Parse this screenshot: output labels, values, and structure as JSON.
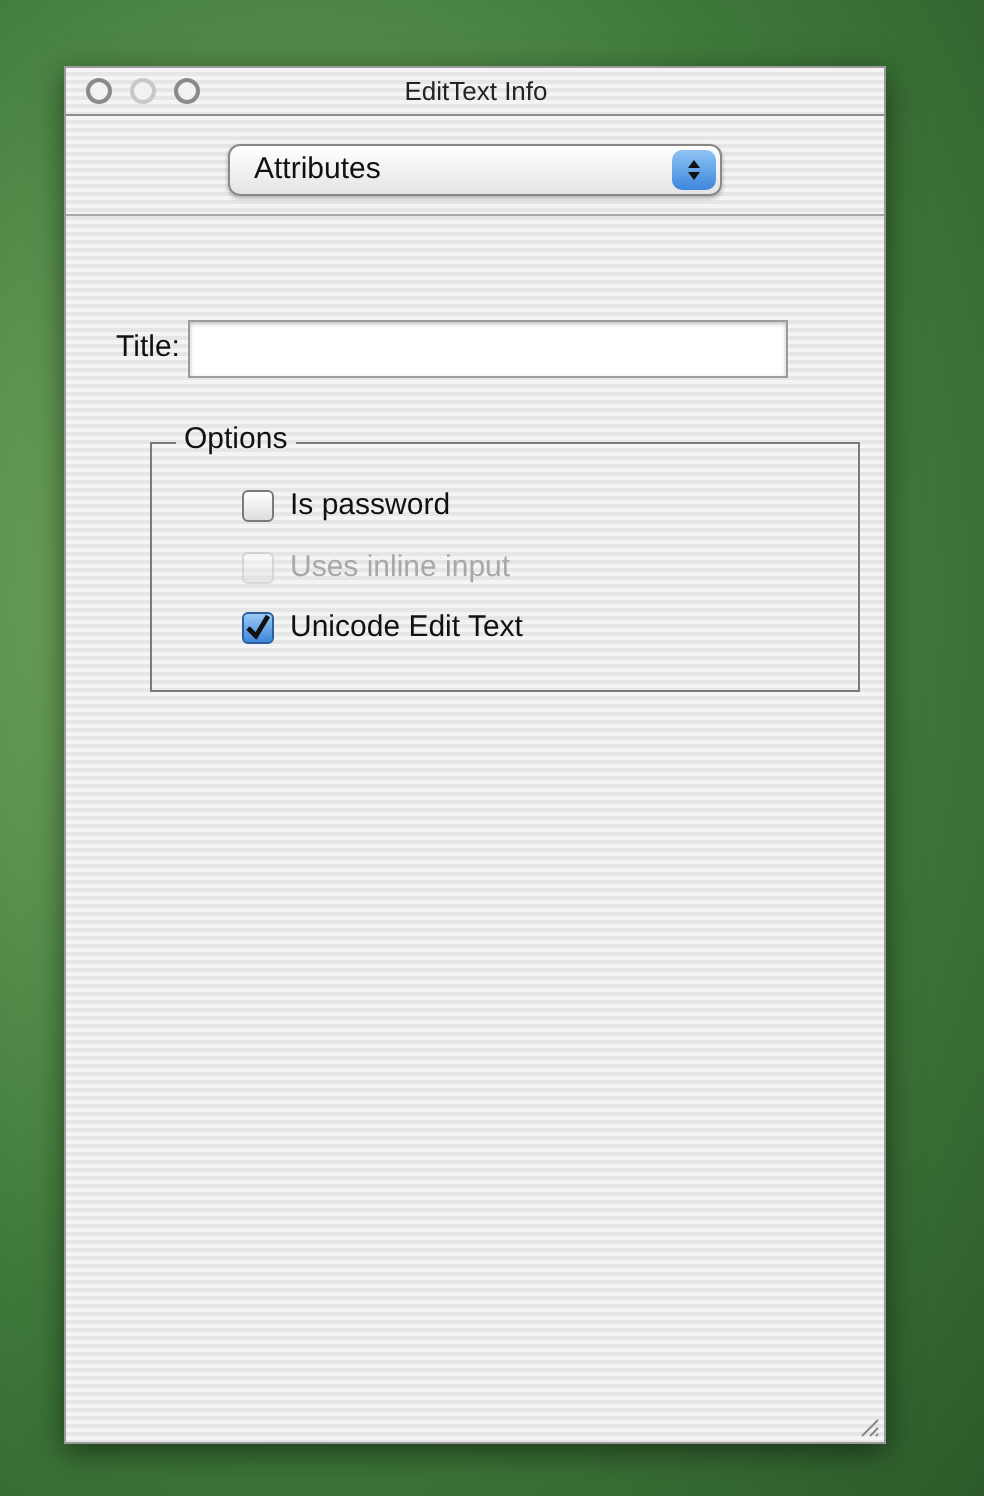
{
  "window": {
    "title": "EditText Info"
  },
  "popup": {
    "value": "Attributes"
  },
  "title_field": {
    "label": "Title:"
  },
  "options": {
    "title": "Options",
    "checkboxes": [
      {
        "label": "Is password",
        "checked": false,
        "disabled": false
      },
      {
        "label": "Uses inline input",
        "checked": false,
        "disabled": true
      },
      {
        "label": "Unicode Edit Text",
        "checked": true,
        "disabled": false
      }
    ]
  }
}
